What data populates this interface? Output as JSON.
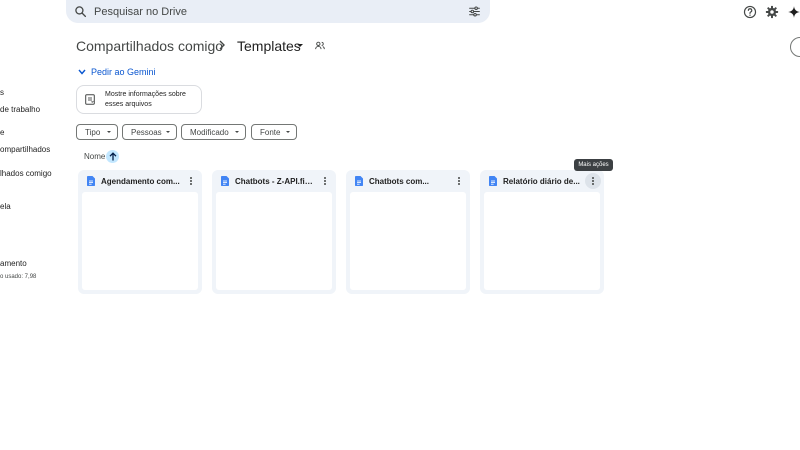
{
  "search": {
    "placeholder": "Pesquisar no Drive"
  },
  "sidebar": {
    "items": [
      {
        "label": "s"
      },
      {
        "label": "de trabalho"
      },
      {
        "label": "e"
      },
      {
        "label": "ompartilhados"
      },
      {
        "label": "lhados comigo"
      },
      {
        "label": "ela"
      },
      {
        "label": "amento"
      },
      {
        "label": "o usado: 7,98"
      }
    ]
  },
  "breadcrumb": {
    "parent": "Compartilhados comigo",
    "current": "Templates"
  },
  "gemini": {
    "label": "Pedir ao Gemini"
  },
  "info_card": {
    "text": "Mostre informações sobre esses arquivos"
  },
  "filters": [
    {
      "label": "Tipo"
    },
    {
      "label": "Pessoas"
    },
    {
      "label": "Modificado"
    },
    {
      "label": "Fonte"
    }
  ],
  "sort": {
    "label": "Nome"
  },
  "files": [
    {
      "name": "Agendamento com..."
    },
    {
      "name": "Chatbots - Z-API.fiqon"
    },
    {
      "name": "Chatbots com..."
    },
    {
      "name": "Relatório diário de..."
    }
  ],
  "tooltip": {
    "text": "Mais ações"
  },
  "colors": {
    "accent": "#0b57d0",
    "doc_blue": "#4285f4",
    "sort_bg": "#c2e7ff",
    "card_bg": "#f0f4f9"
  }
}
